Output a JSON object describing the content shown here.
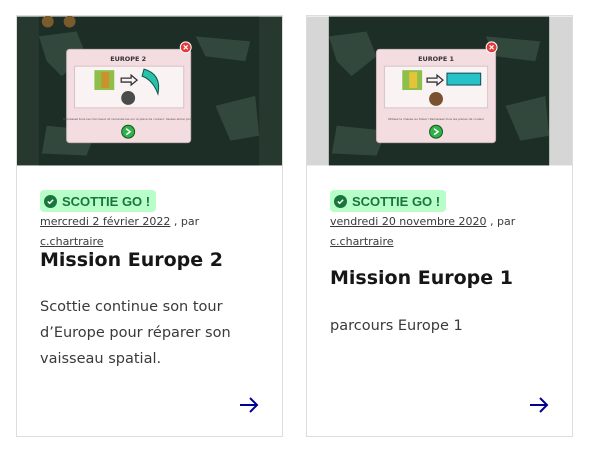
{
  "cards": [
    {
      "badge": "SCOTTIE GO !",
      "date": "mercredi 2 février 2022",
      "by": ", par",
      "author": "c.chartraire",
      "title": "Mission Europe 2",
      "description": "Scottie continue son tour d’Europe pour réparer son vaisseau spatial.",
      "thumbnail": {
        "panel_title": "EUROPE 2",
        "caption": "Ramassez tous les morceaux et ramenez-les sur la pièce de couleur. Seules aimer plus."
      }
    },
    {
      "badge": "SCOTTIE GO !",
      "date": "vendredi 20 novembre 2020",
      "by": ", par",
      "author": "c.chartraire",
      "title": "Mission Europe 1",
      "description": "parcours Europe 1",
      "thumbnail": {
        "panel_title": "EUROPE 1",
        "caption": "Utilisez le chasse au trésor! Ramassez tous les pièces de couleur"
      }
    }
  ],
  "colors": {
    "badge_bg": "#b8fec9",
    "badge_text": "#18753c",
    "link_arrow": "#000091",
    "thumb_bg": "#27392f",
    "panel_bg": "#f3dde0"
  },
  "icons": {
    "badge": "check-circle-icon",
    "link": "arrow-right-icon"
  }
}
